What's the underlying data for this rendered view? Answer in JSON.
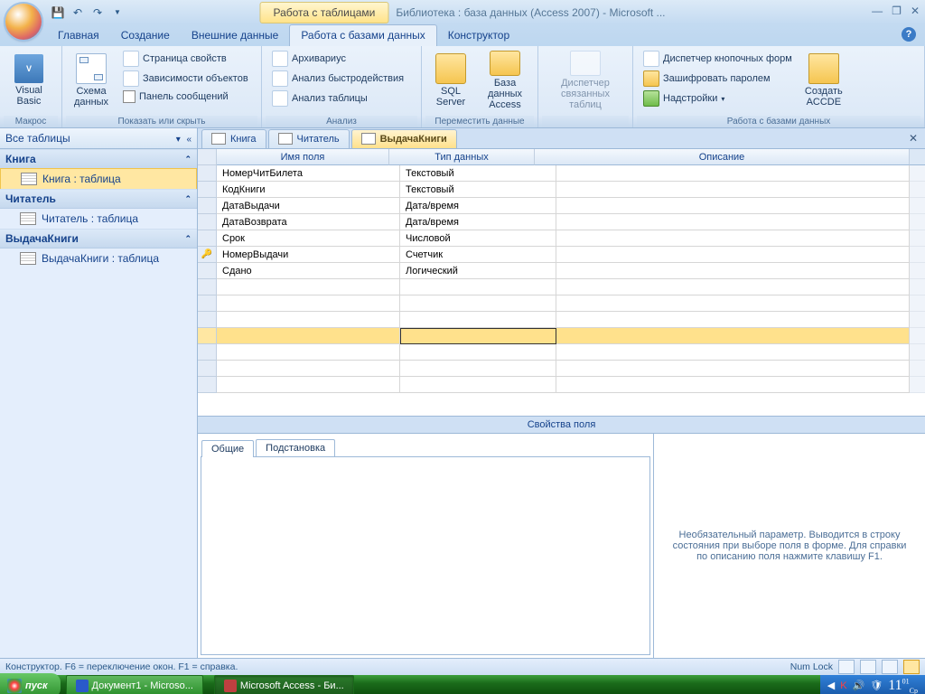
{
  "titlebar": {
    "contextual": "Работа с таблицами",
    "app_title": "Библиотека : база данных (Access 2007) - Microsoft ..."
  },
  "ribbon_tabs": {
    "home": "Главная",
    "create": "Создание",
    "external": "Внешние данные",
    "dbtools": "Работа с базами данных",
    "constructor": "Конструктор"
  },
  "ribbon": {
    "macros": {
      "visual_basic": "Visual\nBasic",
      "label": "Макрос"
    },
    "show_hide": {
      "schema": "Схема\nданных",
      "prop_page": "Страница свойств",
      "deps": "Зависимости объектов",
      "msg_panel": "Панель сообщений",
      "label": "Показать или скрыть"
    },
    "analysis": {
      "archivist": "Архивариус",
      "perf": "Анализ быстродействия",
      "table": "Анализ таблицы",
      "label": "Анализ"
    },
    "move": {
      "sql": "SQL\nServer",
      "access_db": "База данных\nAccess",
      "label": "Переместить данные"
    },
    "linked": {
      "manager": "Диспетчер\nсвязанных таблиц"
    },
    "dbtools": {
      "switchboard": "Диспетчер кнопочных форм",
      "encrypt": "Зашифровать паролем",
      "addins": "Надстройки",
      "label": "Работа с базами данных",
      "make_accde": "Создать\nACCDE"
    }
  },
  "nav": {
    "header": "Все таблицы",
    "groups": [
      {
        "name": "Книга",
        "items": [
          "Книга : таблица"
        ],
        "selected": 0
      },
      {
        "name": "Читатель",
        "items": [
          "Читатель : таблица"
        ]
      },
      {
        "name": "ВыдачаКниги",
        "items": [
          "ВыдачаКниги : таблица"
        ]
      }
    ]
  },
  "doc": {
    "tabs": [
      "Книга",
      "Читатель",
      "ВыдачаКниги"
    ],
    "active": 2,
    "columns": {
      "name": "Имя поля",
      "type": "Тип данных",
      "desc": "Описание"
    },
    "rows": [
      {
        "name": "НомерЧитБилета",
        "type": "Текстовый",
        "key": false
      },
      {
        "name": "КодКниги",
        "type": "Текстовый",
        "key": false
      },
      {
        "name": "ДатаВыдачи",
        "type": "Дата/время",
        "key": false
      },
      {
        "name": "ДатаВозврата",
        "type": "Дата/время",
        "key": false
      },
      {
        "name": "Срок",
        "type": "Числовой",
        "key": false
      },
      {
        "name": "НомерВыдачи",
        "type": "Счетчик",
        "key": true
      },
      {
        "name": "Сдано",
        "type": "Логический",
        "key": false
      }
    ]
  },
  "properties": {
    "divider": "Свойства поля",
    "tabs": {
      "general": "Общие",
      "lookup": "Подстановка"
    },
    "hint": "Необязательный параметр.  Выводится в строку состояния при выборе поля в форме.  Для справки по описанию поля нажмите клавишу F1."
  },
  "status": {
    "left": "Конструктор.  F6 = переключение окон.  F1 = справка.",
    "numlock": "Num Lock"
  },
  "taskbar": {
    "start": "пуск",
    "tasks": [
      "Документ1 - Microso...",
      "Microsoft Access - Би..."
    ],
    "clock": {
      "time": "11",
      "min": "01",
      "day": "Ср"
    }
  }
}
